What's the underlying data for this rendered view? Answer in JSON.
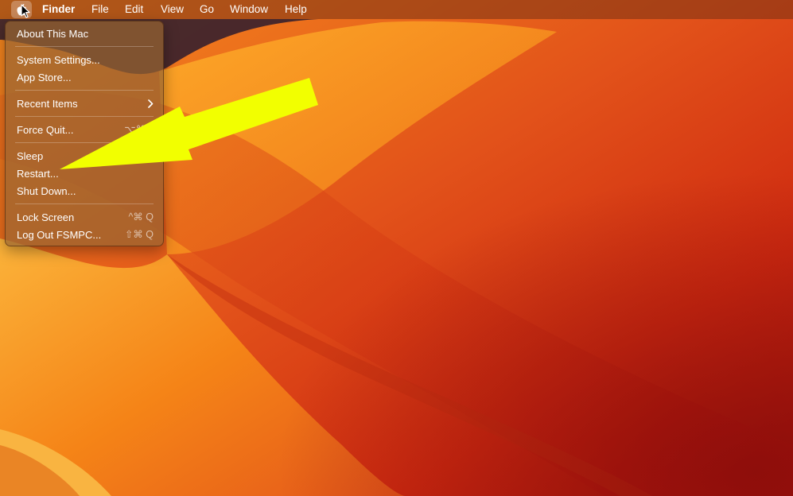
{
  "menubar": {
    "apple_icon": "apple-logo-icon",
    "app_name": "Finder",
    "menus": [
      "File",
      "Edit",
      "View",
      "Go",
      "Window",
      "Help"
    ]
  },
  "apple_menu": {
    "about": "About This Mac",
    "system_settings": "System Settings...",
    "app_store": "App Store...",
    "recent_items": "Recent Items",
    "force_quit": "Force Quit...",
    "force_quit_shortcut": "⌥⌘⎋",
    "sleep": "Sleep",
    "restart": "Restart...",
    "shut_down": "Shut Down...",
    "lock_screen": "Lock Screen",
    "lock_screen_shortcut": "^⌘ Q",
    "log_out": "Log Out FSMPC...",
    "log_out_shortcut": "⇧⌘ Q"
  },
  "colors": {
    "annotation_arrow": "#f2ff00",
    "wallpaper_orange": "#f78a1a",
    "wallpaper_red": "#c9200d"
  }
}
